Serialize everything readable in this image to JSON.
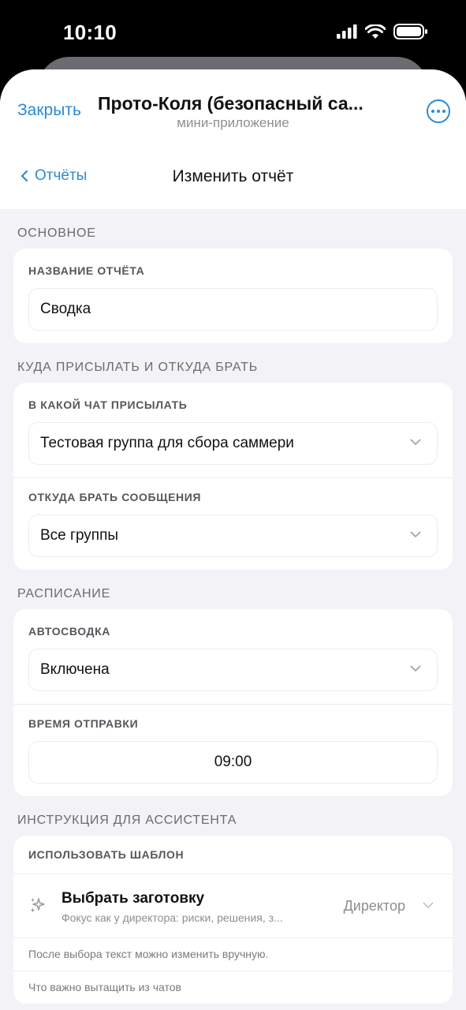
{
  "status": {
    "time": "10:10"
  },
  "header": {
    "close_label": "Закрыть",
    "title": "Прото-Коля (безопасный са...",
    "subtitle": "мини-приложение",
    "more_icon": "ellipsis-circle-icon",
    "back_label": "Отчёты",
    "page_title": "Изменить отчёт"
  },
  "sections": {
    "basic": {
      "title": "ОСНОВНОЕ",
      "report_name_label": "НАЗВАНИЕ ОТЧЁТА",
      "report_name_value": "Сводка"
    },
    "routing": {
      "title": "КУДА ПРИСЫЛАТЬ И ОТКУДА БРАТЬ",
      "chat_label": "В КАКОЙ ЧАТ ПРИСЫЛАТЬ",
      "chat_value": "Тестовая группа для сбора саммери",
      "source_label": "ОТКУДА БРАТЬ СООБЩЕНИЯ",
      "source_value": "Все группы"
    },
    "schedule": {
      "title": "РАСПИСАНИЕ",
      "auto_label": "АВТОСВОДКА",
      "auto_value": "Включена",
      "time_label": "ВРЕМЯ ОТПРАВКИ",
      "time_value": "09:00"
    },
    "assistant": {
      "title": "ИНСТРУКЦИЯ ДЛЯ АССИСТЕНТА",
      "template_label": "ИСПОЛЬЗОВАТЬ ШАБЛОН",
      "template_title": "Выбрать заготовку",
      "template_desc": "Фокус как у директора: риски, решения, з...",
      "template_value": "Директор",
      "hint_edit": "После выбора текст можно изменить вручную.",
      "hint_extract": "Что важно вытащить из чатов"
    }
  },
  "colors": {
    "accent": "#2b8ad6",
    "background": "#f2f2f7",
    "card": "#ffffff"
  }
}
